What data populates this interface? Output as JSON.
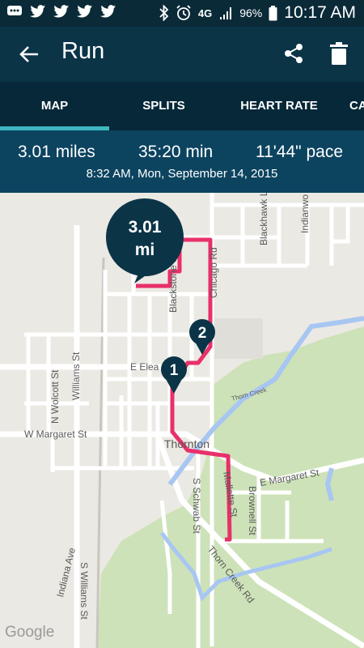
{
  "status_bar": {
    "battery": "96%",
    "time": "10:17 AM",
    "network": "4G"
  },
  "app_bar": {
    "title": "Run"
  },
  "tabs": [
    {
      "label": "MAP",
      "active": true
    },
    {
      "label": "SPLITS",
      "active": false
    },
    {
      "label": "HEART RATE",
      "active": false
    },
    {
      "label": "CA",
      "active": false
    }
  ],
  "summary": {
    "distance": "3.01 miles",
    "duration": "35:20 min",
    "pace": "11'44\" pace",
    "datetime": "8:32 AM, Mon, September 14, 2015"
  },
  "map": {
    "total_marker": {
      "value": "3.01",
      "unit": "mi"
    },
    "mile_markers": [
      "1",
      "2"
    ],
    "street_labels": {
      "blackstone": "Blackstone St",
      "chicago": "Chicago Rd",
      "blackhawk": "Blackhawk L",
      "indianwood": "Indianwo",
      "eleanor": "E Elea",
      "williams_n": "Williams St",
      "wolcott": "N Wolcott St",
      "margaret_w": "W Margaret St",
      "thornton": "Thornton",
      "margaret_e": "E Margaret St",
      "thorn_creek": "Thorn Creek",
      "williams_s": "S Williams St",
      "schwab": "S Schwab St",
      "mallette": "Mallette St",
      "brownell": "Brownell St",
      "thorn_creek_rd": "Thorn Creek Rd",
      "indiana": "Indiana Ave"
    },
    "attribution": "Google",
    "route_color": "#e8306a"
  }
}
